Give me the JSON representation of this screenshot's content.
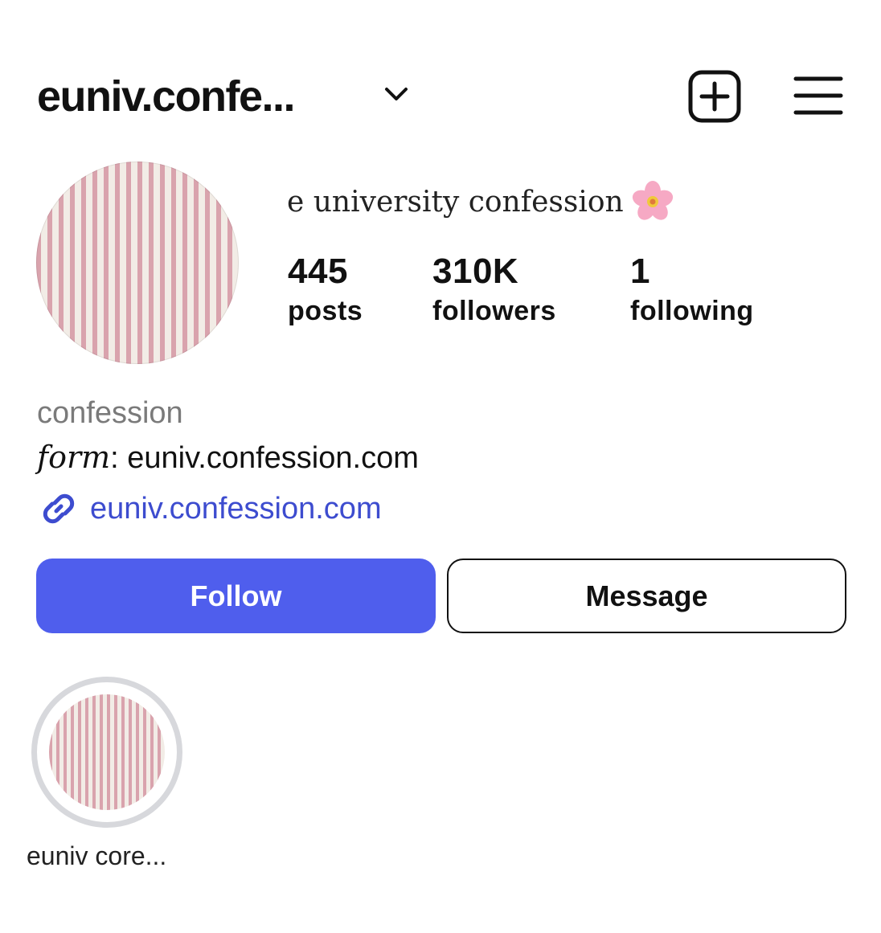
{
  "header": {
    "username": "euniv.confe...",
    "icons": {
      "dropdown": "chevron-down-icon",
      "create": "plus-square-icon",
      "menu": "hamburger-menu-icon"
    }
  },
  "profile": {
    "display_name": "e university confession",
    "display_name_emoji": "cherry-blossom-icon",
    "stats": {
      "posts": {
        "value": "445",
        "label": "posts"
      },
      "followers": {
        "value": "310K",
        "label": "followers"
      },
      "following": {
        "value": "1",
        "label": "following"
      }
    },
    "category": "confession",
    "bio": {
      "prefix": "form",
      "separator": ": ",
      "text": "euniv.confession.com"
    },
    "link": {
      "icon": "link-icon",
      "text": "euniv.confession.com"
    }
  },
  "actions": {
    "follow_label": "Follow",
    "message_label": "Message"
  },
  "highlights": [
    {
      "label": "euniv core..."
    }
  ],
  "colors": {
    "accent": "#4f5eed",
    "link": "#3d4ccf",
    "muted_text": "#7a7a7a",
    "stripe_pink": "#d9a3ad",
    "stripe_cream": "#f2ece6"
  }
}
